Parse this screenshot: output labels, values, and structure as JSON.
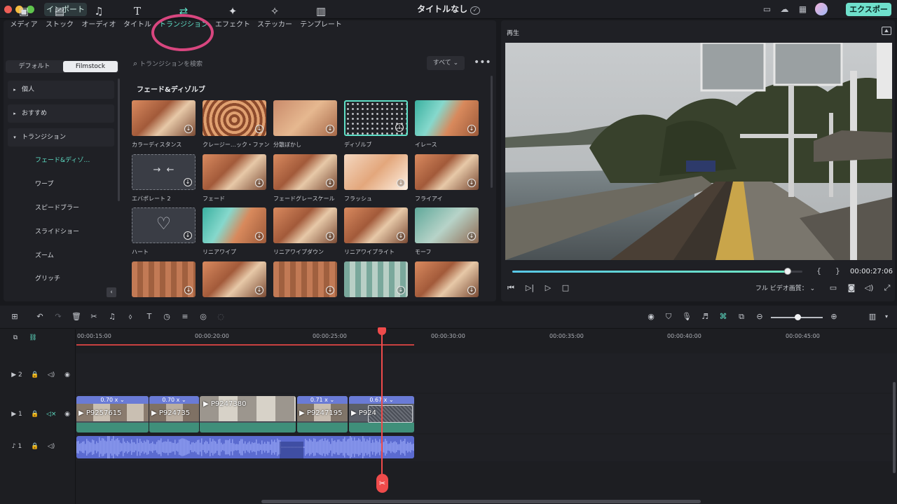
{
  "titlebar": {
    "import_label": "インポート",
    "title": "タイトルなし",
    "export_label": "エクスポート",
    "colors": {
      "accent": "#6fe0cc",
      "highlight_ring": "#d8467f"
    }
  },
  "tools": [
    {
      "name": "media",
      "label": "メディア",
      "icon": "image-icon"
    },
    {
      "name": "stock",
      "label": "ストック",
      "icon": "cloud-icon"
    },
    {
      "name": "audio",
      "label": "オーディオ",
      "icon": "music-note-icon"
    },
    {
      "name": "title",
      "label": "タイトル",
      "icon": "text-t-icon"
    },
    {
      "name": "transition",
      "label": "トランジション",
      "icon": "transition-arrows-icon",
      "active": true
    },
    {
      "name": "effect",
      "label": "エフェクト",
      "icon": "sparkle-icon"
    },
    {
      "name": "sticker",
      "label": "ステッカー",
      "icon": "sticker-icon"
    },
    {
      "name": "template",
      "label": "テンプレート",
      "icon": "template-icon"
    }
  ],
  "library": {
    "tabs": [
      "デフォルト",
      "Filmstock"
    ],
    "search_placeholder": "トランジションを検索",
    "filter_label": "すべて",
    "section_title": "フェード&ディゾルブ"
  },
  "sidebar": {
    "groups": [
      "個人",
      "おすすめ",
      "トランジション"
    ],
    "subitems": [
      "フェード&ディゾ…",
      "ワープ",
      "スピードブラー",
      "スライドショー",
      "ズーム",
      "グリッチ"
    ]
  },
  "tiles": [
    {
      "label": "カラーディスタンス",
      "style": "photo"
    },
    {
      "label": "クレージー…ック・ファン",
      "style": "warp"
    },
    {
      "label": "分散ぼかし",
      "style": "blur"
    },
    {
      "label": "ディゾルブ",
      "style": "dots"
    },
    {
      "label": "イレース",
      "style": "wave"
    },
    {
      "label": "エバポレート 2",
      "style": "arrows"
    },
    {
      "label": "フェード",
      "style": "photo"
    },
    {
      "label": "フェードグレースケール",
      "style": "photo"
    },
    {
      "label": "フラッシュ",
      "style": "bright"
    },
    {
      "label": "フライアイ",
      "style": "photo"
    },
    {
      "label": "ハート",
      "style": "heart"
    },
    {
      "label": "リニアワイプ",
      "style": "wave"
    },
    {
      "label": "リニアワイプダウン",
      "style": "photo"
    },
    {
      "label": "リニアワイプライト",
      "style": "photo"
    },
    {
      "label": "モーフ",
      "style": "teal"
    },
    {
      "label": "",
      "style": "pixel"
    },
    {
      "label": "",
      "style": "photo"
    },
    {
      "label": "",
      "style": "pixel"
    },
    {
      "label": "",
      "style": "tealpixel"
    },
    {
      "label": "",
      "style": "photo"
    }
  ],
  "player": {
    "label": "再生",
    "timecode": "00:00:27:06",
    "progress": 0.95,
    "quality_label": "フル ビデオ画質：",
    "braces": [
      "{",
      "}"
    ]
  },
  "timeline": {
    "ruler": [
      "00:00:15:00",
      "00:00:20:00",
      "00:00:25:00",
      "00:00:30:00",
      "00:00:35:00",
      "00:00:40:00",
      "00:00:45:00"
    ],
    "tracks": {
      "v2": "2",
      "v1": "1",
      "a1": "1"
    },
    "clips": [
      {
        "speed": "0.70 x",
        "name": "P9257615"
      },
      {
        "speed": "0.70 x",
        "name": "P924735"
      },
      {
        "speed": "",
        "name": "P9247380"
      },
      {
        "speed": "0.71 x",
        "name": "P9247195"
      },
      {
        "speed": "0.67 x",
        "name": "P924"
      }
    ]
  }
}
